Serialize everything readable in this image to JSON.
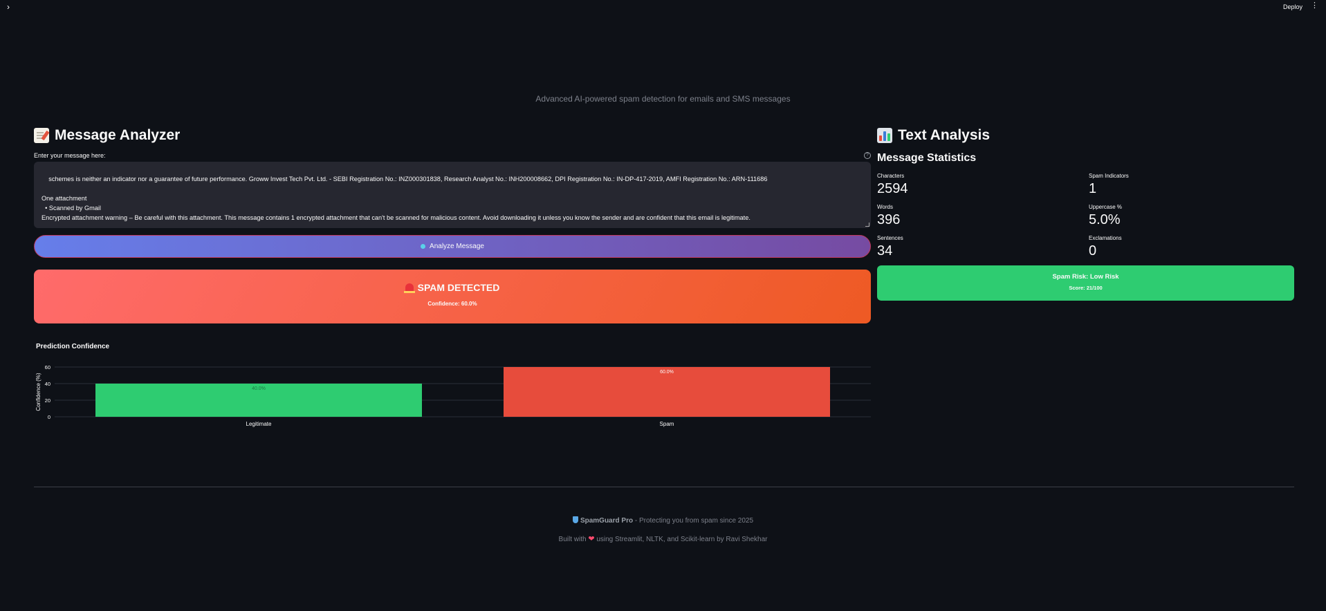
{
  "topbar": {
    "sidebar_toggle": "›",
    "deploy_label": "Deploy",
    "menu_icon": "⋮"
  },
  "header": {
    "subtitle": "Advanced AI-powered spam detection for emails and SMS messages"
  },
  "analyzer": {
    "title": "Message Analyzer",
    "input_label": "Enter your message here:",
    "help_icon": "?",
    "message_text": "schemes is neither an indicator nor a guarantee of future performance. Groww Invest Tech Pvt. Ltd. - SEBI Registration No.: INZ000301838, Research Analyst No.: INH200008662, DPI Registration No.: IN-DP-417-2019, AMFI Registration No.: ARN-111686\n\nOne attachment\n  • Scanned by Gmail\nEncrypted attachment warning – Be careful with this attachment. This message contains 1 encrypted attachment that can't be scanned for malicious content. Avoid downloading it unless you know the sender and are confident that this email is legitimate.",
    "analyze_button": "Analyze Message",
    "result_title": "SPAM DETECTED",
    "result_confidence": "Confidence: 60.0%",
    "chart_title": "Prediction Confidence"
  },
  "chart_data": {
    "type": "bar",
    "categories": [
      "Legitimate",
      "Spam"
    ],
    "values": [
      40.0,
      60.0
    ],
    "data_labels": [
      "40.0%",
      "60.0%"
    ],
    "colors": [
      "#2ecc71",
      "#e74c3c"
    ],
    "ylabel": "Confidence (%)",
    "xlabel": "",
    "ylim": [
      0,
      60
    ],
    "yticks": [
      0,
      20,
      40,
      60
    ],
    "grid": true
  },
  "analysis": {
    "title": "Text Analysis",
    "stats_title": "Message Statistics",
    "stats": [
      {
        "label": "Characters",
        "value": "2594"
      },
      {
        "label": "Spam Indicators",
        "value": "1"
      },
      {
        "label": "Words",
        "value": "396"
      },
      {
        "label": "Uppercase %",
        "value": "5.0%"
      },
      {
        "label": "Sentences",
        "value": "34"
      },
      {
        "label": "Exclamations",
        "value": "0"
      }
    ],
    "risk_title": "Spam Risk: Low Risk",
    "risk_score": "Score: 21/100"
  },
  "footer": {
    "brand": "SpamGuard Pro",
    "tagline": " - Protecting you from spam since 2025",
    "built_prefix": "Built with ",
    "heart": "❤",
    "built_suffix": " using Streamlit, NLTK, and Scikit-learn by Ravi Shekhar"
  },
  "colors": {
    "background": "#0e1117",
    "spam": "#ee5a24",
    "legit": "#2ecc71",
    "accent": "#667eea"
  }
}
